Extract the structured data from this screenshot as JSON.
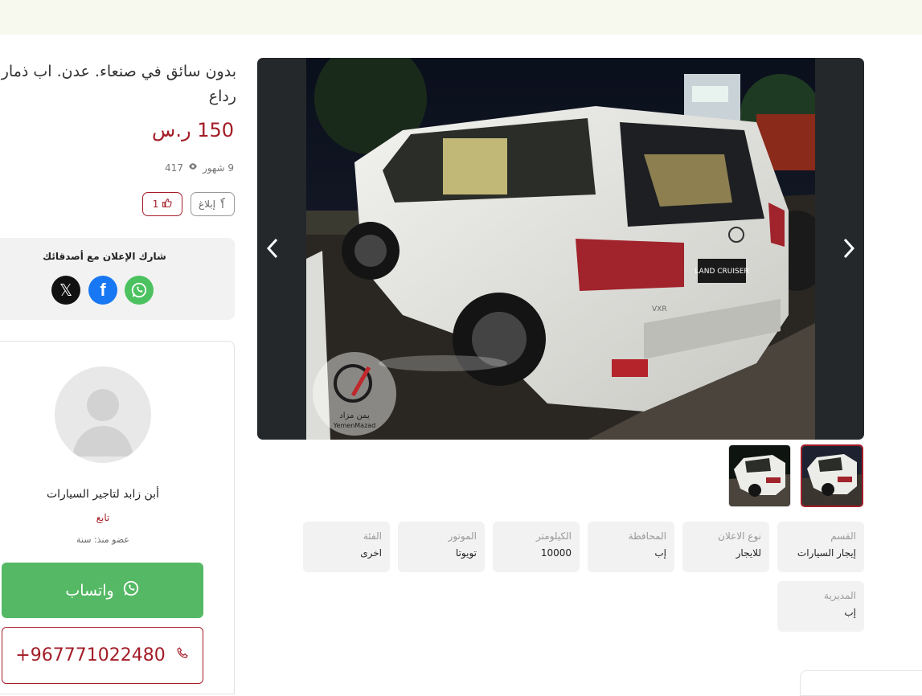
{
  "listing": {
    "title": "بدون سائق في صنعاء. عدن. اب ذمار رداع",
    "price": "150 ر.س",
    "age": "9 شهور",
    "views": "417",
    "likes": "1",
    "report_label": "إبلاغ"
  },
  "share": {
    "title": "شارك الإعلان مع أصدقائك"
  },
  "seller": {
    "name": "أبن زابد لتاجير السيارات",
    "follow_label": "تابع",
    "member_since": "عضو منذ: سنة",
    "whatsapp_label": "واتساب",
    "phone": "+967771022480"
  },
  "gallery": {
    "watermark_ar": "يمن مزاد",
    "watermark_en": "YemenMazad",
    "plate_text": "LAND CRUISER",
    "badge_text": "VXR"
  },
  "attributes": [
    {
      "label": "القسم",
      "value": "إيجار السيارات"
    },
    {
      "label": "نوع الاعلان",
      "value": "للايجار"
    },
    {
      "label": "المحافظة",
      "value": "إب"
    },
    {
      "label": "الكيلومتر",
      "value": "10000"
    },
    {
      "label": "الموتور",
      "value": "تويوتا"
    },
    {
      "label": "الفئة",
      "value": "اخرى"
    },
    {
      "label": "المديرية",
      "value": "إب"
    }
  ],
  "colors": {
    "accent": "#a31c27",
    "whatsapp": "#54b864",
    "facebook": "#1877f2",
    "topbar": "#f7f9ef"
  },
  "icons": [
    "eye-icon",
    "thumbs-up-icon",
    "flag-icon",
    "x-icon",
    "facebook-icon",
    "whatsapp-icon",
    "phone-icon",
    "chevron-left-icon",
    "chevron-right-icon"
  ]
}
